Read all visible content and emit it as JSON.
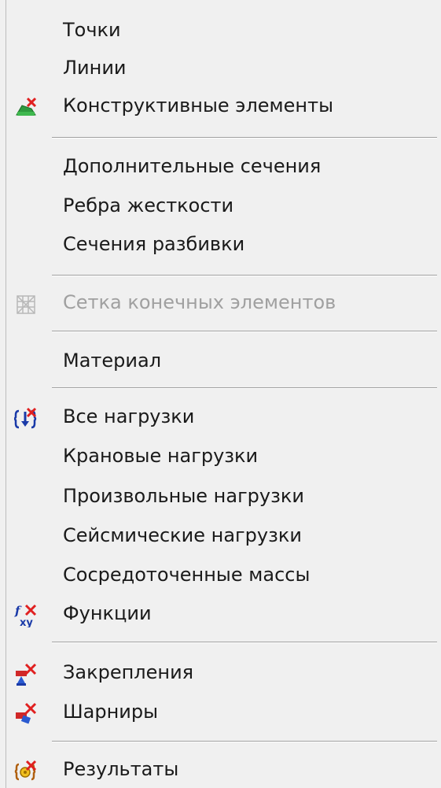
{
  "menu": {
    "items": [
      {
        "label": "Точки",
        "icon": null,
        "disabled": false
      },
      {
        "label": "Линии",
        "icon": null,
        "disabled": false
      },
      {
        "label": "Конструктивные элементы",
        "icon": "structural-elements-icon",
        "disabled": false
      },
      {
        "label": "Дополнительные сечения",
        "icon": null,
        "disabled": false
      },
      {
        "label": "Ребра жесткости",
        "icon": null,
        "disabled": false
      },
      {
        "label": "Сечения разбивки",
        "icon": null,
        "disabled": false
      },
      {
        "label": "Сетка конечных элементов",
        "icon": "mesh-icon",
        "disabled": true
      },
      {
        "label": "Материал",
        "icon": null,
        "disabled": false
      },
      {
        "label": "Все нагрузки",
        "icon": "all-loads-icon",
        "disabled": false
      },
      {
        "label": "Крановые нагрузки",
        "icon": null,
        "disabled": false
      },
      {
        "label": "Произвольные нагрузки",
        "icon": null,
        "disabled": false
      },
      {
        "label": "Сейсмические нагрузки",
        "icon": null,
        "disabled": false
      },
      {
        "label": "Сосредоточенные массы",
        "icon": null,
        "disabled": false
      },
      {
        "label": "Функции",
        "icon": "functions-icon",
        "disabled": false
      },
      {
        "label": "Закрепления",
        "icon": "supports-icon",
        "disabled": false
      },
      {
        "label": "Шарниры",
        "icon": "hinges-icon",
        "disabled": false
      },
      {
        "label": "Результаты",
        "icon": "results-icon",
        "disabled": false
      }
    ],
    "icon_glyphs": {
      "functions": {
        "f": "f",
        "xy": "xy"
      }
    },
    "colors": {
      "background": "#f0f0f0",
      "text": "#1a1a1a",
      "disabled_text": "#a0a0a0",
      "separator": "#a0a0a0",
      "delete_mark": "#e02020"
    }
  }
}
